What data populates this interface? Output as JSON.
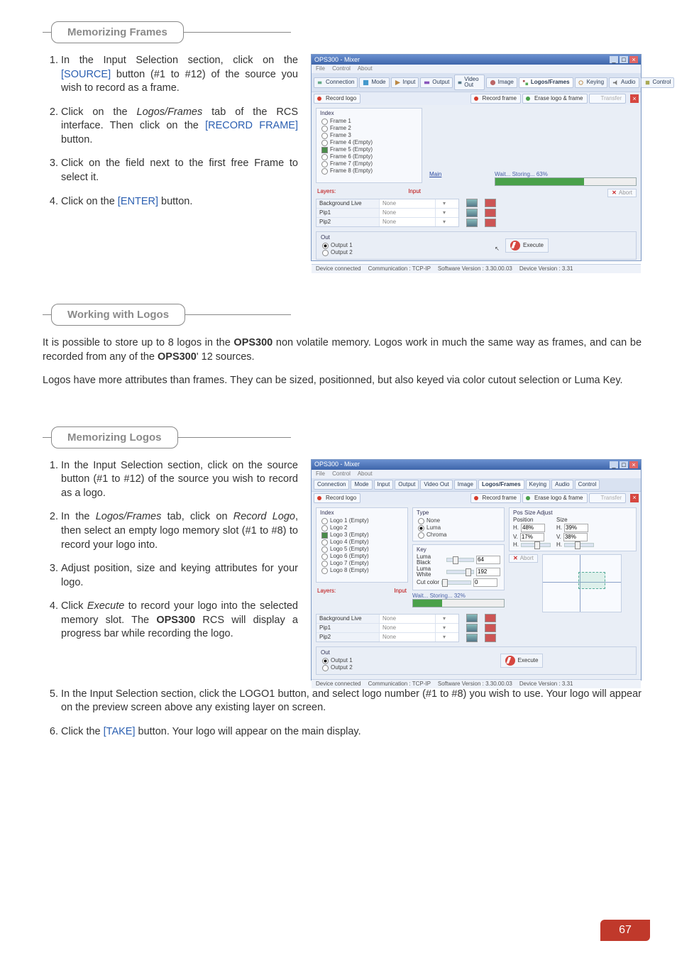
{
  "page_number": "67",
  "sections": {
    "mem_frames": "Memorizing Frames",
    "logos": "Working with Logos",
    "mem_logos": "Memorizing Logos"
  },
  "frames_steps": [
    {
      "pre": "In the Input Selection section, click on the ",
      "link": "[SOURCE]",
      "post": " button (#1 to #12) of the source you wish to record as a frame."
    },
    {
      "pre": "Click on the ",
      "em": "Logos/Frames",
      "mid": " tab of the RCS interface. Then click on the ",
      "link": "[RECORD FRAME]",
      "post": " button."
    },
    {
      "text": "Click on the field next to the first free Frame to select it."
    },
    {
      "pre": "Click on the ",
      "link": "[ENTER]",
      "post": " button."
    }
  ],
  "logos_intro_1a": "It is possible to store up to 8 logos in the ",
  "logos_intro_1b": " non volatile memory. Logos work in much the same way as frames, and can be recorded from any of the ",
  "logos_intro_1c": "' 12 sources.",
  "logos_intro_2": "Logos have more attributes than frames. They can be sized, positionned, but also keyed via color cutout selection or Luma Key.",
  "device": "OPS300",
  "logos_steps": [
    {
      "text": "In the Input Selection section, click on the source button (#1 to #12) of the source you wish to record as a logo."
    },
    {
      "pre": "In the ",
      "em": "Logos/Frames",
      "mid": " tab, click on ",
      "em2": "Record Logo",
      "post": ", then select an empty logo memory slot (#1 to #8) to record your logo into."
    },
    {
      "text": "Adjust position, size and keying attributes for your logo."
    },
    {
      "pre": "Click ",
      "em": "Execute",
      "mid": " to record your logo into the selected memory slot. The ",
      "bold": "OPS300",
      "post": " RCS will display a progress bar while recording the logo."
    },
    {
      "text": "In the Input Selection section, click the LOGO1 button, and select logo number (#1 to #8) you wish to use. Your logo will appear on the preview screen above any existing layer on screen."
    },
    {
      "pre": "Click the ",
      "link": "[TAKE]",
      "post": " button. Your logo will appear on the main display."
    }
  ],
  "app": {
    "title": "OPS300 - Mixer",
    "menus": [
      "File",
      "Control",
      "About"
    ],
    "tabs": [
      "Connection",
      "Mode",
      "Input",
      "Output",
      "Video Out",
      "Image",
      "Logos/Frames",
      "Keying",
      "Audio",
      "Control"
    ],
    "subtabs": {
      "record_logo": "Record logo",
      "record_frame": "Record frame",
      "erase": "Erase logo & frame",
      "transfer": "Transfer"
    },
    "index_label": "Index",
    "frames": [
      "Frame 1",
      "Frame 2",
      "Frame 3",
      "Frame 4 (Empty)",
      "Frame 5 (Empty)",
      "Frame 6 (Empty)",
      "Frame 7 (Empty)",
      "Frame 8 (Empty)"
    ],
    "logos": [
      "Logo 1 (Empty)",
      "Logo 2",
      "Logo 3 (Empty)",
      "Logo 4 (Empty)",
      "Logo 5 (Empty)",
      "Logo 6 (Empty)",
      "Logo 7 (Empty)",
      "Logo 8 (Empty)"
    ],
    "layers": "Layers:",
    "input": "Input",
    "main_u": "Main",
    "grid_rows": [
      "Background Live",
      "Pip1",
      "Pip2"
    ],
    "grid_none": "None",
    "out_label": "Out",
    "out1": "Output 1",
    "out2": "Output 2",
    "execute": "Execute",
    "progress1": {
      "label": "Wait... Storing... 63%",
      "percent": 63
    },
    "progress2": {
      "label": "Wait... Storing... 32%",
      "percent": 32
    },
    "abort": "Abort",
    "status": {
      "conn": "Device connected",
      "comm": "Communication : TCP-IP",
      "sw": "Software Version : 3.30.00.03",
      "dev": "Device Version : 3.31"
    },
    "type_panel": {
      "title": "Type",
      "none": "None",
      "luma": "Luma",
      "chroma": "Chroma"
    },
    "key_panel": {
      "title": "Key",
      "lb": "Luma Black",
      "lw": "Luma White",
      "cut": "Cut color",
      "v1": "64",
      "v2": "192",
      "v3": "0"
    },
    "pos_panel": {
      "title": "Pos Size Adjust",
      "position": "Position",
      "size": "Size",
      "h": "H.",
      "v": "V.",
      "ph": "48%",
      "pv": "17%",
      "sh": "39%",
      "sv": "38%"
    }
  }
}
